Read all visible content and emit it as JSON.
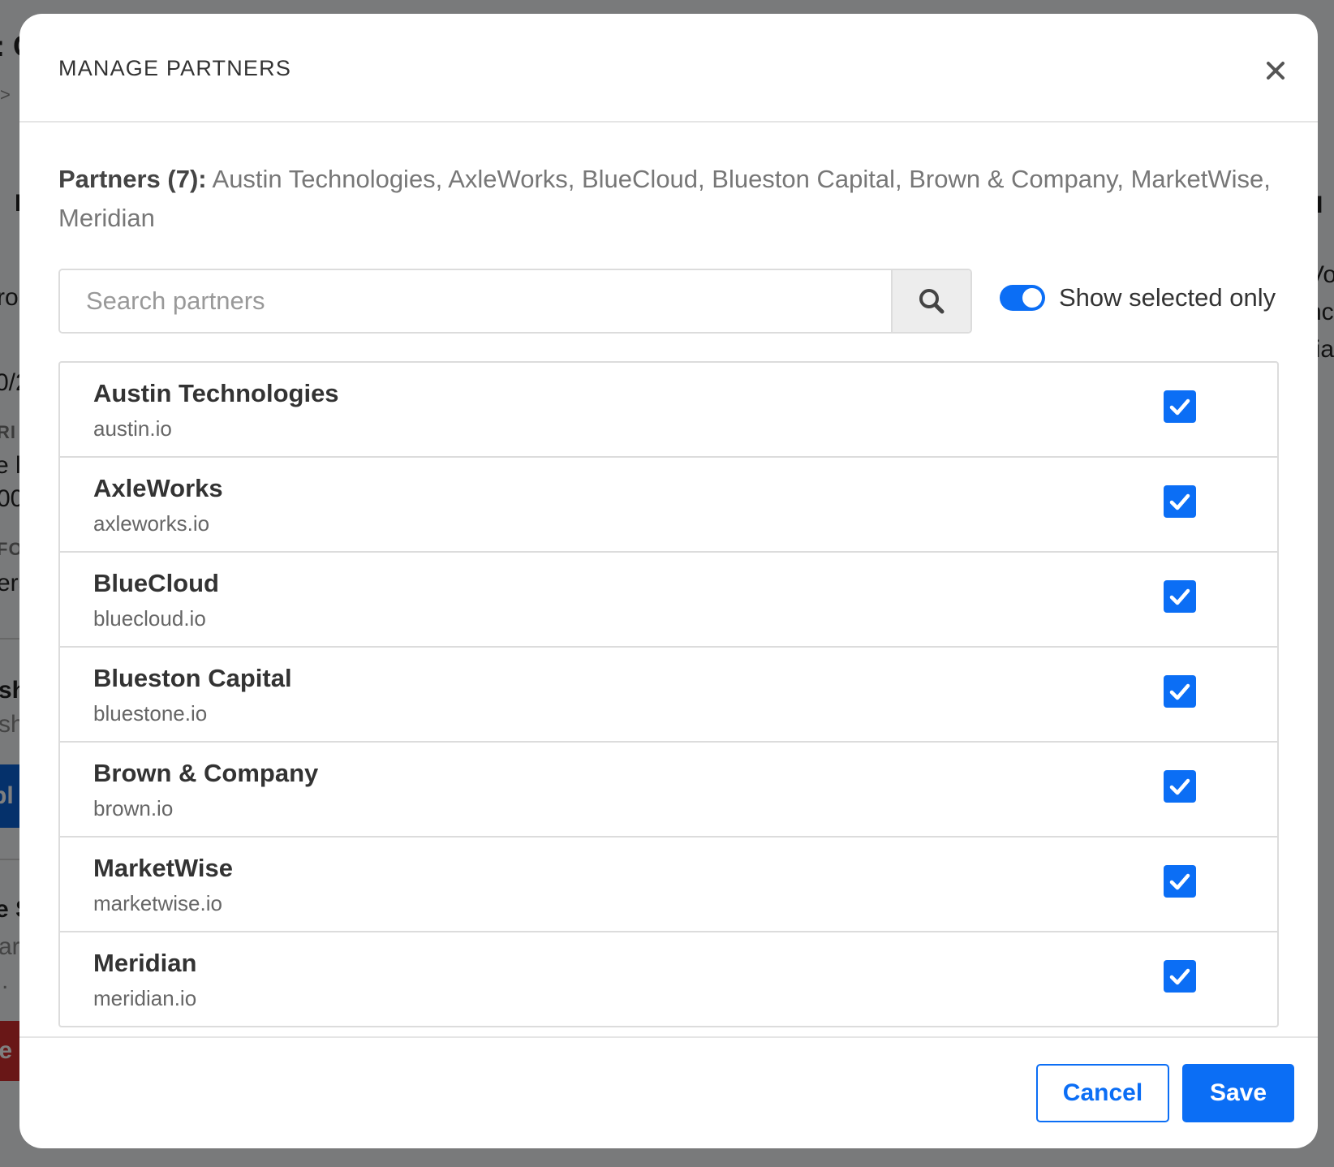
{
  "background": {
    "left_fragments": [
      ": C",
      ">",
      "I",
      "ro",
      "0/2",
      "RI",
      "e l",
      "00",
      "FO",
      "era",
      "sh",
      "sh",
      "bl",
      "e S",
      "ar",
      ".",
      "le"
    ],
    "right_fragments": [
      "I",
      "Vo",
      "nc",
      "lia"
    ]
  },
  "modal": {
    "title": "MANAGE PARTNERS",
    "close_icon": "close-icon",
    "summary": {
      "label": "Partners (7):",
      "names": "Austin Technologies, AxleWorks, BlueCloud, Blueston Capital, Brown & Company, MarketWise, Meridian"
    },
    "search": {
      "placeholder": "Search partners",
      "value": "",
      "icon": "search-icon"
    },
    "toggle": {
      "label": "Show selected only",
      "on": true
    },
    "partners": [
      {
        "name": "Austin Technologies",
        "domain": "austin.io",
        "checked": true
      },
      {
        "name": "AxleWorks",
        "domain": "axleworks.io",
        "checked": true
      },
      {
        "name": "BlueCloud",
        "domain": "bluecloud.io",
        "checked": true
      },
      {
        "name": "Blueston Capital",
        "domain": "bluestone.io",
        "checked": true
      },
      {
        "name": "Brown & Company",
        "domain": "brown.io",
        "checked": true
      },
      {
        "name": "MarketWise",
        "domain": "marketwise.io",
        "checked": true
      },
      {
        "name": "Meridian",
        "domain": "meridian.io",
        "checked": true
      }
    ],
    "footer": {
      "cancel_label": "Cancel",
      "save_label": "Save"
    }
  },
  "colors": {
    "accent": "#0b6ef5",
    "text_dark": "#333333",
    "text_muted": "#777777",
    "border": "#dcdcdc"
  }
}
